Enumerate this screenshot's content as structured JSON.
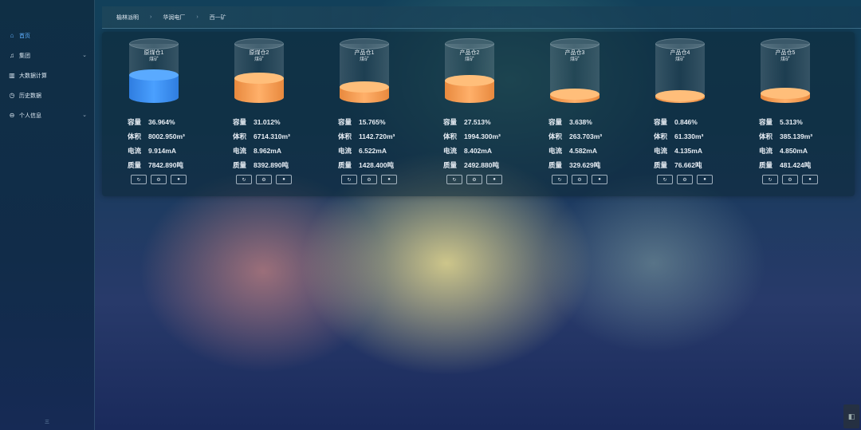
{
  "sidebar": {
    "items": [
      {
        "label": "首页",
        "icon": "home-icon",
        "active": true
      },
      {
        "label": "集团",
        "icon": "group-icon",
        "has_submenu": true
      },
      {
        "label": "大数据计算",
        "icon": "bar-chart-icon"
      },
      {
        "label": "历史数据",
        "icon": "history-icon"
      },
      {
        "label": "个人信息",
        "icon": "user-icon",
        "has_submenu": true
      }
    ],
    "footer": "三"
  },
  "breadcrumb": [
    "榆林派明",
    "华润电厂",
    "西一矿"
  ],
  "labels": {
    "capacity": "容量",
    "volume": "体积",
    "current": "电流",
    "mass": "质量"
  },
  "tanks": [
    {
      "name": "原煤仓1",
      "sub": "煤矿",
      "fill_percent": 36.964,
      "color": "blue",
      "capacity": "36.964%",
      "volume": "8002.950m³",
      "current": "9.914mA",
      "mass": "7842.890吨"
    },
    {
      "name": "原煤仓2",
      "sub": "煤矿",
      "fill_percent": 31.012,
      "color": "orange",
      "capacity": "31.012%",
      "volume": "6714.310m³",
      "current": "8.962mA",
      "mass": "8392.890吨"
    },
    {
      "name": "产品仓1",
      "sub": "煤矿",
      "fill_percent": 15.765,
      "color": "orange",
      "capacity": "15.765%",
      "volume": "1142.720m³",
      "current": "6.522mA",
      "mass": "1428.400吨"
    },
    {
      "name": "产品仓2",
      "sub": "煤矿",
      "fill_percent": 27.513,
      "color": "orange",
      "capacity": "27.513%",
      "volume": "1994.300m³",
      "current": "8.402mA",
      "mass": "2492.880吨"
    },
    {
      "name": "产品仓3",
      "sub": "煤矿",
      "fill_percent": 3.638,
      "color": "orange",
      "capacity": "3.638%",
      "volume": "263.703m³",
      "current": "4.582mA",
      "mass": "329.629吨"
    },
    {
      "name": "产品仓4",
      "sub": "煤矿",
      "fill_percent": 0.846,
      "color": "orange",
      "capacity": "0.846%",
      "volume": "61.330m³",
      "current": "4.135mA",
      "mass": "76.662吨"
    },
    {
      "name": "产品仓5",
      "sub": "煤矿",
      "fill_percent": 5.313,
      "color": "orange",
      "capacity": "5.313%",
      "volume": "385.139m³",
      "current": "4.850mA",
      "mass": "481.424吨"
    }
  ],
  "tank_buttons": [
    {
      "icon": "refresh-icon",
      "glyph": "↻"
    },
    {
      "icon": "settings-icon",
      "glyph": "⚙"
    },
    {
      "icon": "detail-icon",
      "glyph": "●"
    }
  ],
  "colors": {
    "accent": "#5fb0ff",
    "blue_liquid": "#3d8ff5",
    "orange_liquid": "#f7a35a"
  }
}
